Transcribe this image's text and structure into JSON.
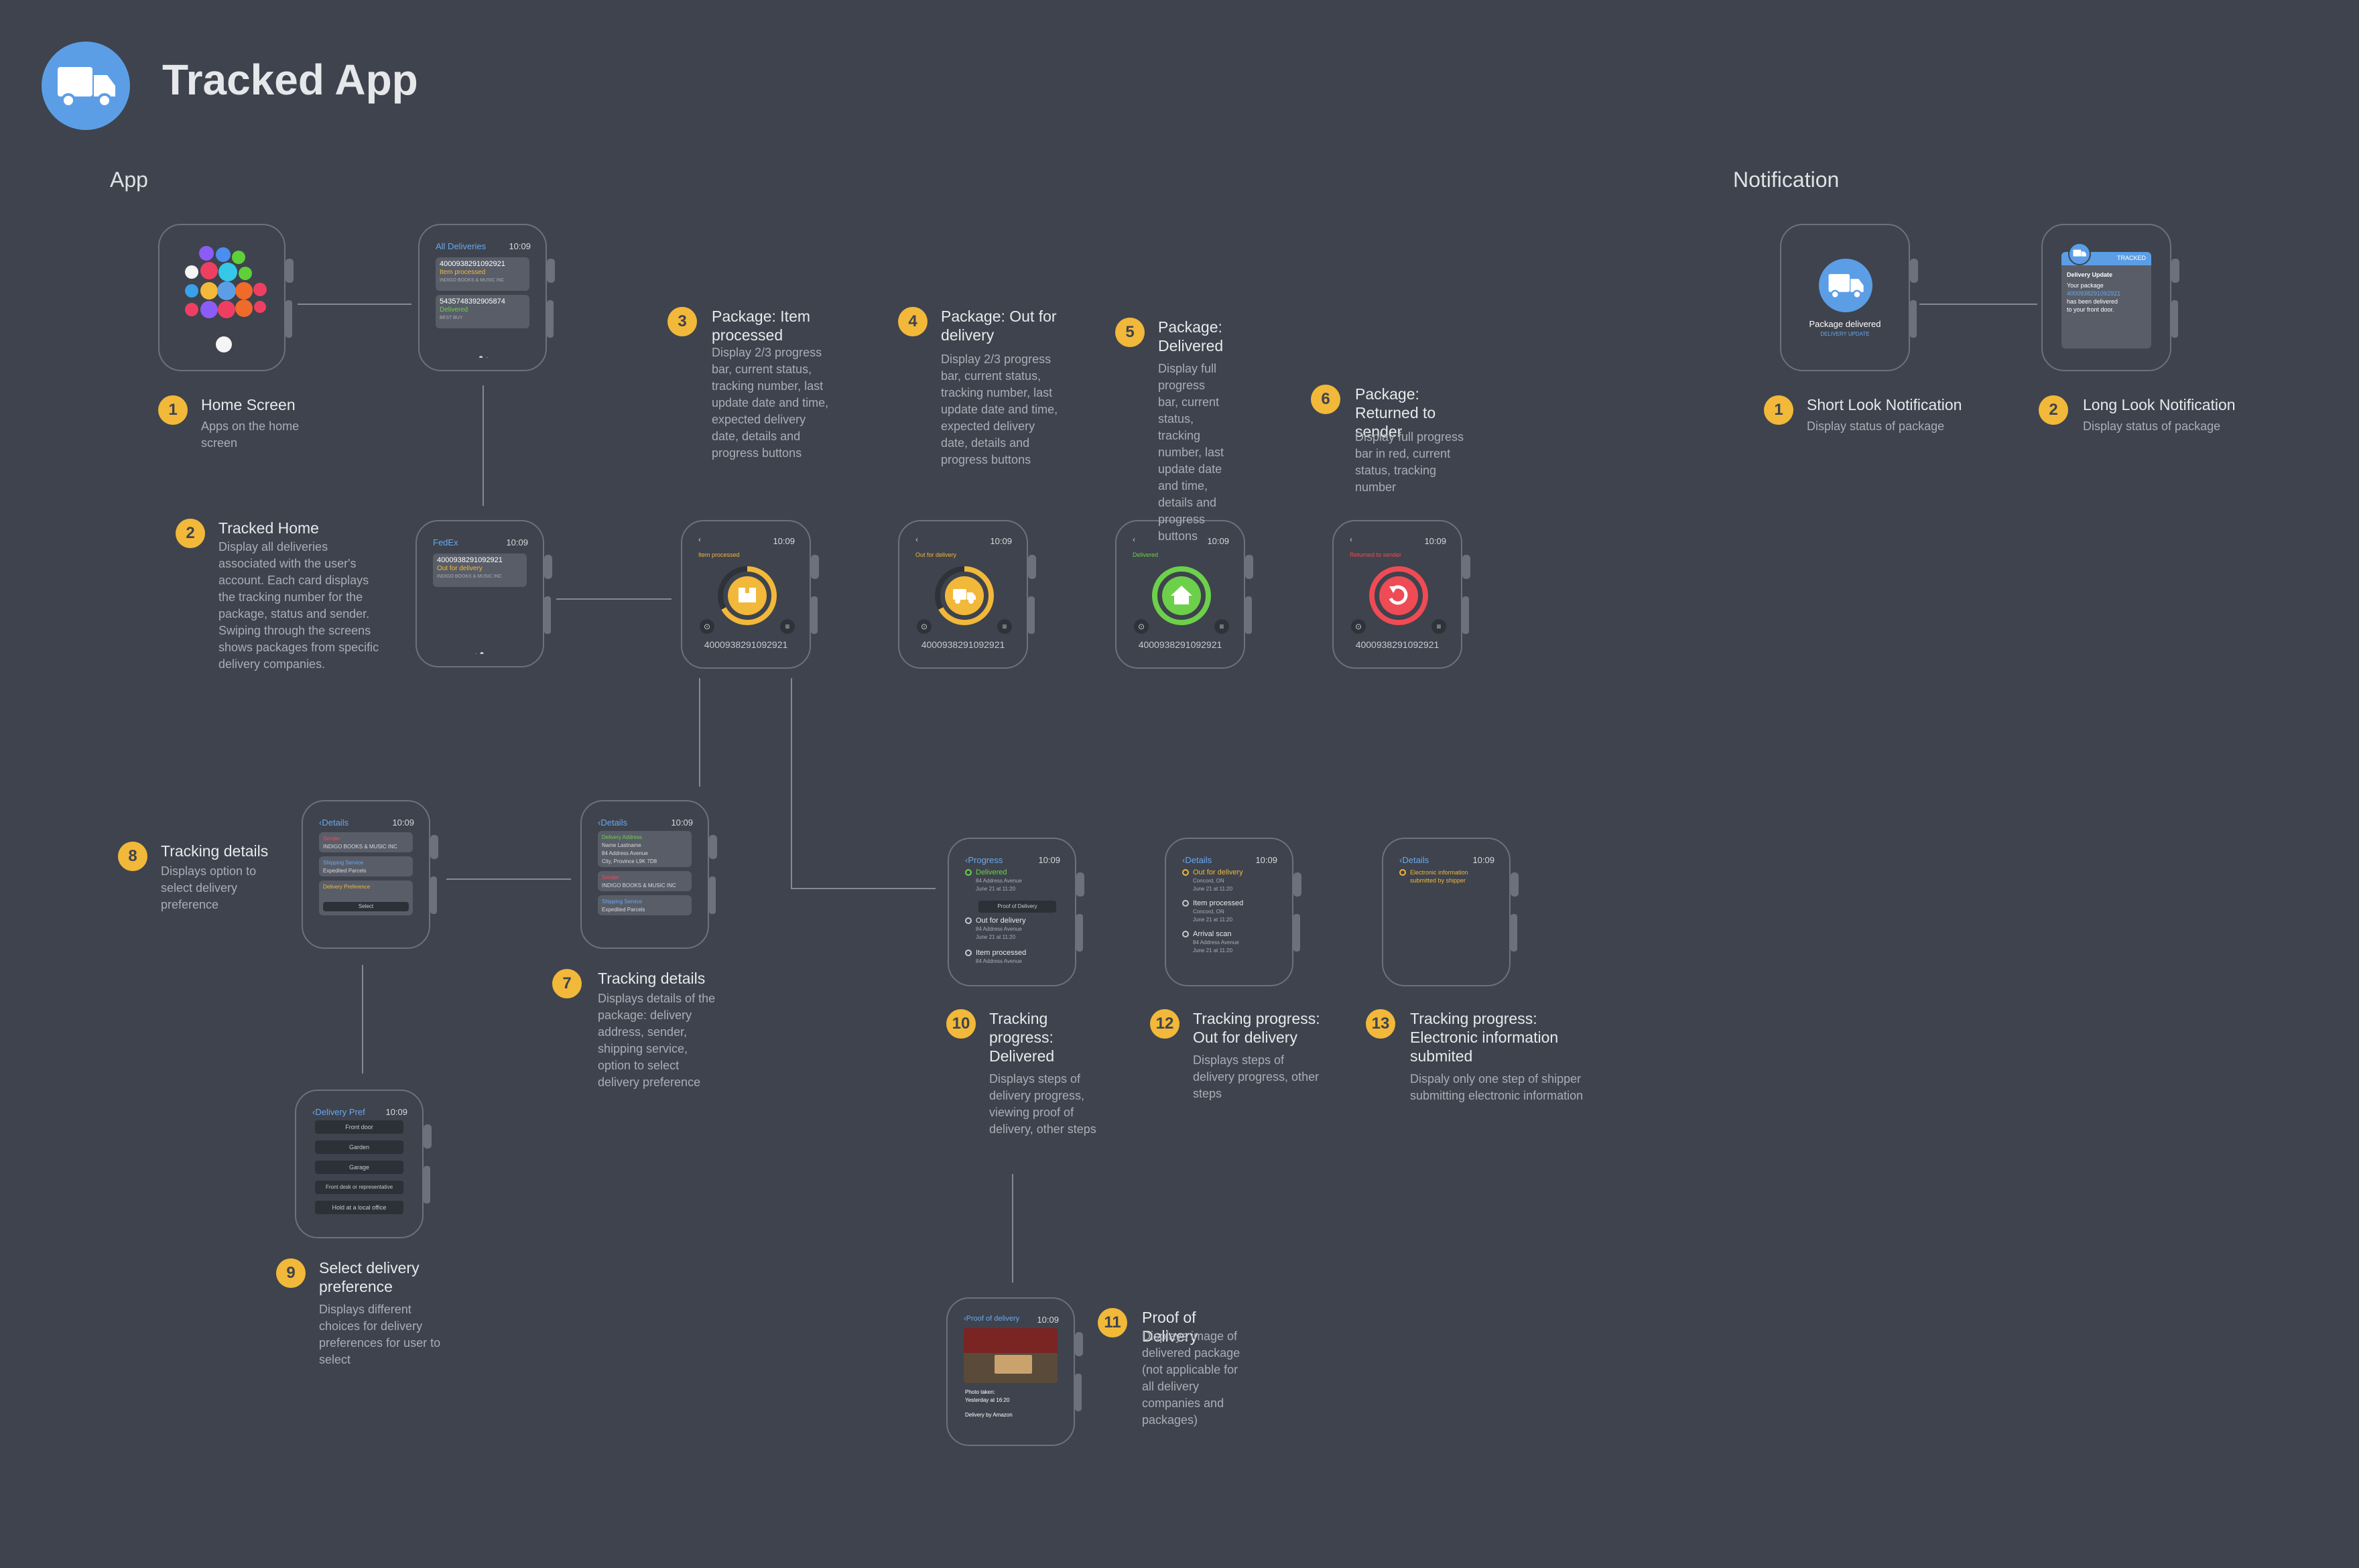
{
  "app_title": "Tracked App",
  "sections": {
    "app": "App",
    "notification": "Notification"
  },
  "colors": {
    "background": "#3e434d",
    "accent_blue": "#5b9ee6",
    "badge_yellow": "#f2b83a",
    "status_orange": "#f2b83a",
    "status_green": "#6dd04a",
    "status_red": "#ef4b55",
    "link_blue": "#6aa8ee"
  },
  "time": "10:09",
  "labels": [
    {
      "num": "1",
      "title": "Home Screen",
      "desc": "Apps on the home screen"
    },
    {
      "num": "2",
      "title": "Tracked Home",
      "desc": "Display all deliveries associated with the user's account. Each card displays the tracking number for the package, status and sender. Swiping through the screens shows packages from specific delivery companies."
    },
    {
      "num": "3",
      "title": "Package: Item processed",
      "desc": "Display 2/3 progress bar, current status, tracking number, last update date and time, expected delivery date, details and progress buttons"
    },
    {
      "num": "4",
      "title": "Package: Out for delivery",
      "desc": "Display 2/3 progress bar, current status, tracking number, last update date and time, expected delivery date, details and progress buttons"
    },
    {
      "num": "5",
      "title": "Package: Delivered",
      "desc": "Display full progress bar, current status, tracking number, last update date and time, details and progress buttons"
    },
    {
      "num": "6",
      "title": "Package: Returned to sender",
      "desc": "Display full progress bar in red, current status, tracking number"
    },
    {
      "num": "7",
      "title": "Tracking details",
      "desc": "Displays details of the package: delivery address, sender, shipping service, option to select delivery preference"
    },
    {
      "num": "8",
      "title": "Tracking details",
      "desc": "Displays option to select delivery preference"
    },
    {
      "num": "9",
      "title": "Select delivery preference",
      "desc": "Displays different choices for delivery preferences for user to select"
    },
    {
      "num": "10",
      "title": "Tracking progress: Delivered",
      "desc": "Displays steps of delivery progress, viewing proof of delivery, other steps"
    },
    {
      "num": "11",
      "title": "Proof of Delivery",
      "desc": "Displays image of delivered package (not applicable for all delivery companies and packages)"
    },
    {
      "num": "12",
      "title": "Tracking progress: Out for delivery",
      "desc": "Displays steps of delivery progress, other steps"
    },
    {
      "num": "13",
      "title": "Tracking progress: Electronic information submited",
      "desc": "Dispaly only one step of shipper submitting electronic information"
    },
    {
      "num": "1",
      "title": "Short Look Notification",
      "desc": "Display status of package"
    },
    {
      "num": "2",
      "title": "Long Look Notification",
      "desc": "Display status of package"
    }
  ],
  "all_deliveries": {
    "title": "All Deliveries",
    "cards": [
      {
        "number": "4000938291092921",
        "status": "Item processed",
        "sender": "INDIGO BOOKS & MUSIC INC"
      },
      {
        "number": "5435748392905874",
        "status": "Delivered",
        "sender": "BEST BUY"
      }
    ]
  },
  "fedex": {
    "title": "FedEx",
    "number": "4000938291092921",
    "status": "Out for delivery",
    "sender": "INDIGO BOOKS & MUSIC INC"
  },
  "packages": [
    {
      "status": "Item processed",
      "icon": "box-icon",
      "color": "#f2b83a",
      "progress": 0.67,
      "number": "4000938291092921"
    },
    {
      "status": "Out for delivery",
      "icon": "truck-icon",
      "color": "#f2b83a",
      "progress": 0.67,
      "number": "4000938291092921"
    },
    {
      "status": "Delivered",
      "icon": "home-icon",
      "color": "#6dd04a",
      "progress": 1.0,
      "number": "4000938291092921"
    },
    {
      "status": "Returned to sender",
      "icon": "return-icon",
      "color": "#ef4b55",
      "progress": 1.0,
      "number": "4000938291092921"
    }
  ],
  "details7": {
    "title": "Details",
    "delivery_address_label": "Delivery Address",
    "address_lines": [
      "Name Lastname",
      "84 Address Avenue",
      "City, Province L9K 7D8"
    ],
    "sender_label": "Sender",
    "sender": "INDIGO BOOKS & MUSIC INC",
    "shipping_label": "Shipping Service",
    "shipping": "Expedited Parcels"
  },
  "details8": {
    "title": "Details",
    "sender_label": "Sender",
    "sender": "INDIGO BOOKS & MUSIC INC",
    "shipping_label": "Shipping Service",
    "shipping": "Expedited Parcels",
    "preference_label": "Delivery Preference",
    "select": "Select"
  },
  "delivery_pref": {
    "title": "Delivery Pref",
    "options": [
      "Front door",
      "Garden",
      "Garage",
      "Front desk or representative",
      "Hold at a local office"
    ]
  },
  "progress10": {
    "title": "Progress",
    "proof_button": "Proof of Delivery",
    "steps": [
      {
        "title": "Delivered",
        "addr": "84 Address Avenue",
        "date": "June 21 at 11:20",
        "color": "#6dd04a"
      },
      {
        "title": "Out for delivery",
        "addr": "84 Address Avenue",
        "date": "June 21 at 11:20",
        "color": "#c8cad0"
      },
      {
        "title": "Item processed",
        "addr": "84 Address Avenue",
        "date": "",
        "color": "#c8cad0"
      }
    ]
  },
  "progress12": {
    "title": "Details",
    "steps": [
      {
        "title": "Out for delivery",
        "addr": "Concord, ON",
        "date": "June 21 at 11:20",
        "color": "#f2b83a"
      },
      {
        "title": "Item processed",
        "addr": "Concord, ON",
        "date": "June 21 at 11:20",
        "color": "#c8cad0"
      },
      {
        "title": "Arrival scan",
        "addr": "84 Address Avenue",
        "date": "June 21 at 11:20",
        "color": "#c8cad0"
      }
    ]
  },
  "progress13": {
    "title": "Details",
    "step": "Electronic information submitted by shipper"
  },
  "proof": {
    "title": "Proof of delivery",
    "photo_label": "Photo taken:",
    "photo_time": "Yesterday at 16:20",
    "delivered_by": "Delivery by Amazon"
  },
  "short_look": {
    "title": "Package delivered",
    "subtitle": "DELIVERY UPDATE"
  },
  "long_look": {
    "app": "TRACKED",
    "heading": "Delivery Update",
    "line1": "Your package",
    "number": "4000938291092921",
    "line2": "has been delivered",
    "line3": "to your front door."
  }
}
